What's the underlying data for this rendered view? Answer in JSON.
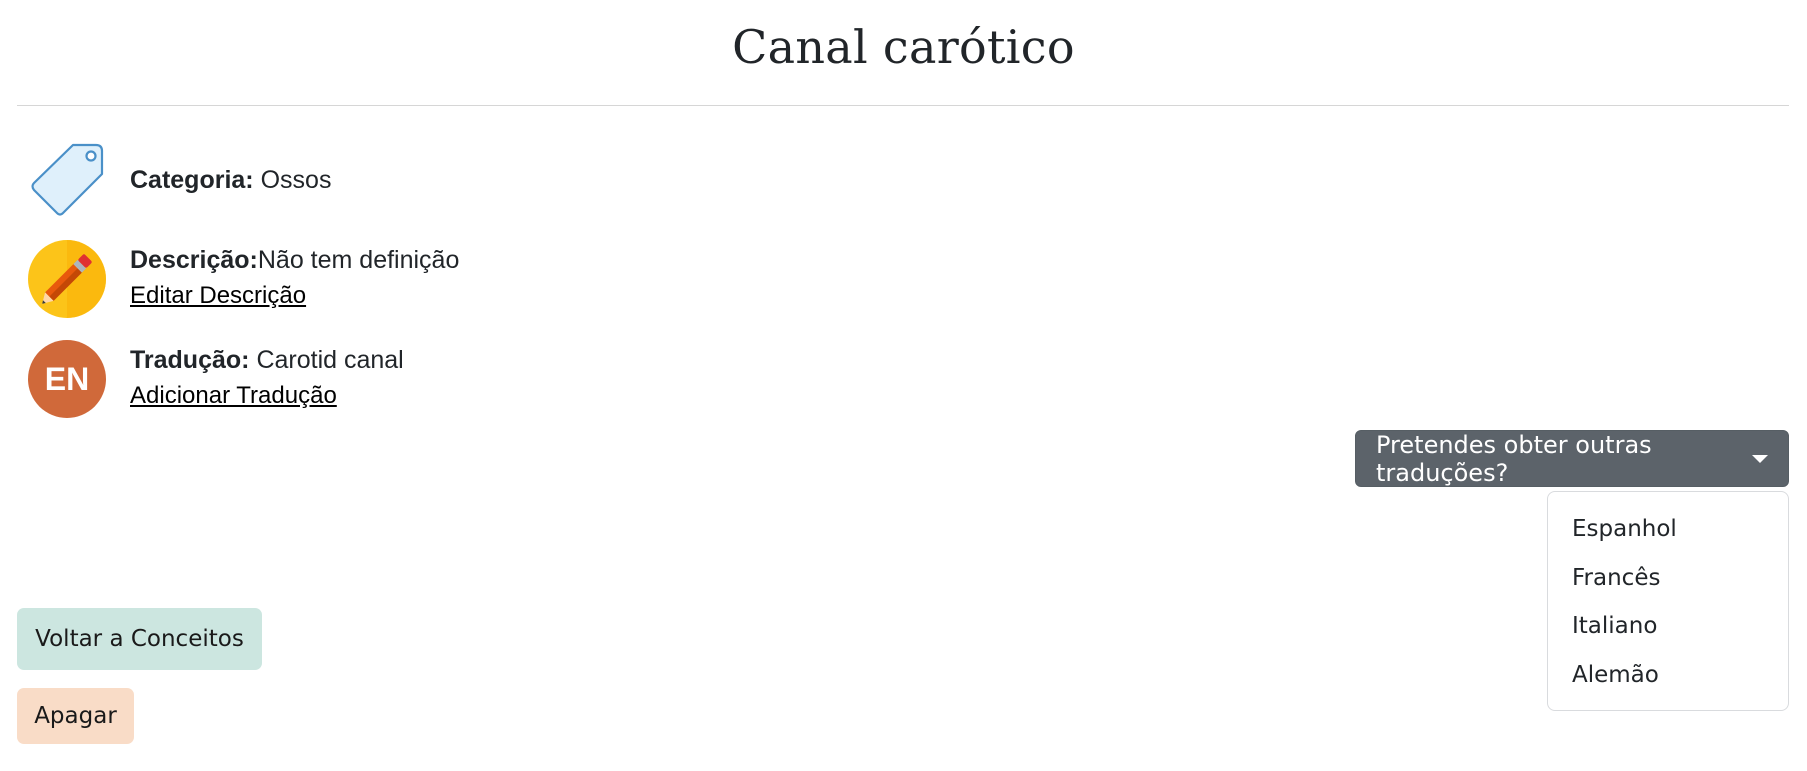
{
  "page": {
    "title": "Canal carótico"
  },
  "category": {
    "label": "Categoria:",
    "value": "Ossos",
    "icon": "tag-icon"
  },
  "description": {
    "label": "Descrição:",
    "value": "Não tem definição",
    "edit_link": "Editar Descrição",
    "icon": "pencil-icon"
  },
  "translation": {
    "label": "Tradução:",
    "value": "Carotid canal",
    "add_link": "Adicionar Tradução",
    "badge": "EN",
    "badge_color": "#d0693a"
  },
  "other_translations": {
    "toggle_label": "Pretendes obter outras traduções?",
    "options": [
      "Espanhol",
      "Francês",
      "Italiano",
      "Alemão"
    ]
  },
  "actions": {
    "back_label": "Voltar a Conceitos",
    "delete_label": "Apagar"
  },
  "colors": {
    "dropdown_bg": "#5c636a",
    "back_bg": "#cce6e0",
    "delete_bg": "#f9dcc7",
    "tag_fill": "#dff0fb",
    "tag_stroke": "#4a90c8",
    "pencil_circle": "#fcc419"
  }
}
